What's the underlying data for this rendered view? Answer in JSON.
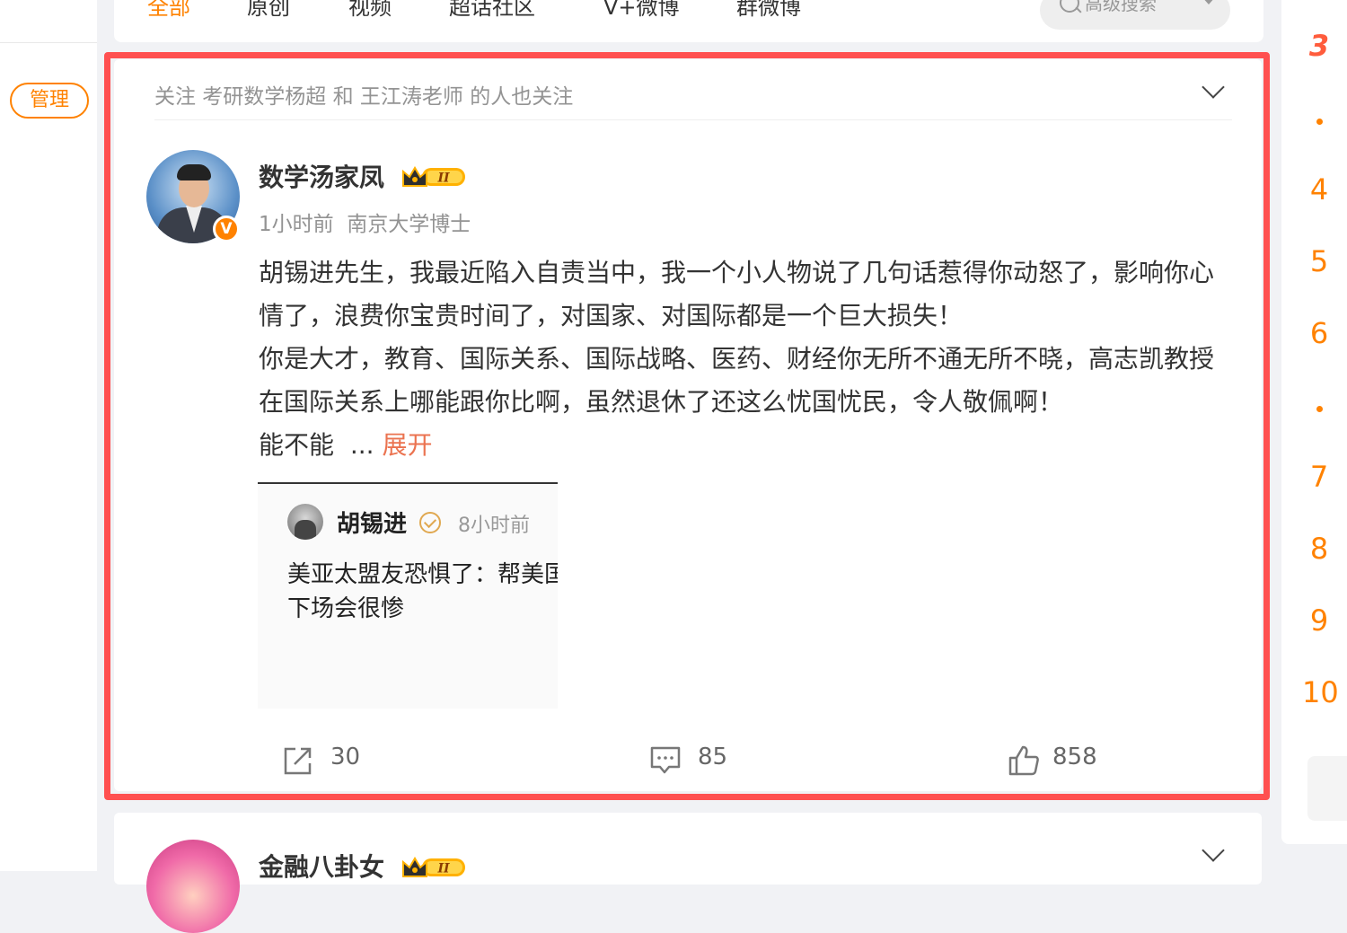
{
  "nav": {
    "tabs": [
      {
        "label": "全部",
        "active": true
      },
      {
        "label": "原创",
        "active": false
      },
      {
        "label": "视频",
        "active": false
      },
      {
        "label": "超话社区",
        "active": false
      },
      {
        "label": "V+微博",
        "active": false
      },
      {
        "label": "群微博",
        "active": false
      }
    ],
    "advanced_search": "高级搜索"
  },
  "sidebar": {
    "manage_label": "管理"
  },
  "post": {
    "hint": "关注 考研数学杨超 和 王江涛老师 的人也关注",
    "author": "数学汤家凤",
    "verified_icon": "v-verified-icon",
    "vip_level": "II",
    "time": "1小时前",
    "source": "南京大学博士",
    "text_p1": "胡锡进先生，我最近陷入自责当中，我一个小人物说了几句话惹得你动怒了，影响你心情了，浪费你宝贵时间了，对国家、对国际都是一个巨大损失！",
    "text_p2": "你是大才，教育、国际关系、国际战略、医药、财经你无所不通无所不晓，高志凯教授在国际关系上哪能跟你比啊，虽然退休了还这么忧国忧民，令人敬佩啊！",
    "text_p3": "能不能",
    "ellipsis": "...",
    "expand_label": "展开",
    "repost": {
      "author": "胡锡进",
      "time": "8小时前",
      "text": "美亚太盟友恐惧了：帮美国的下场会很惨"
    },
    "actions": {
      "share_count": "30",
      "comment_count": "85",
      "like_count": "858"
    }
  },
  "next_post": {
    "author": "金融八卦女",
    "vip_level": "II"
  },
  "hot_ranks": [
    "3",
    "4",
    "5",
    "6",
    "7",
    "8",
    "9",
    "10"
  ],
  "colors": {
    "accent": "#ff8200",
    "highlight_border": "#ff5050",
    "expand": "#eb7350"
  }
}
